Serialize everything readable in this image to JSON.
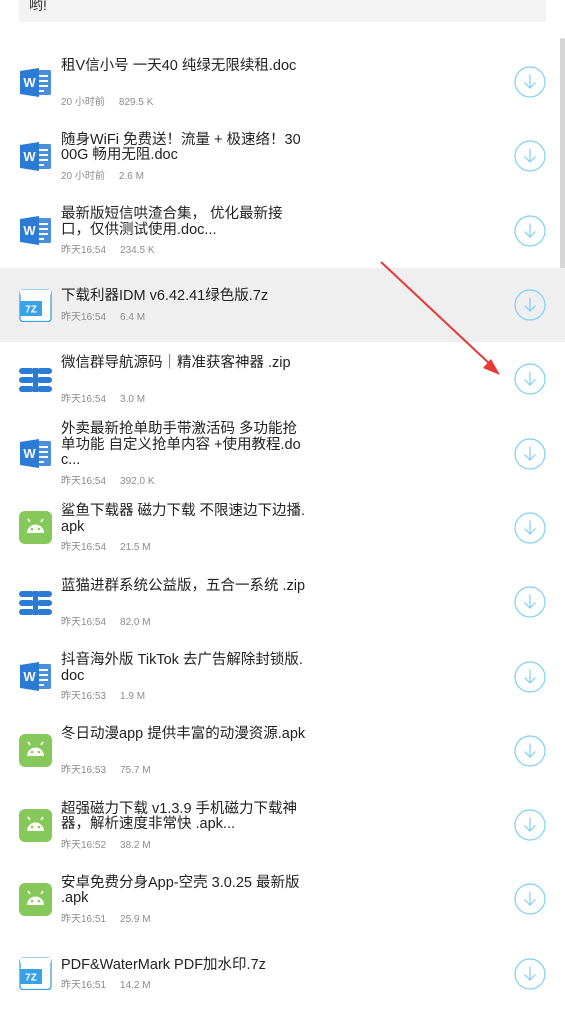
{
  "banner": {
    "text": "哟!"
  },
  "files": [
    {
      "icon": "word",
      "title": "租V信小号 一天40 纯绿无限续租.doc",
      "time": "20 小时前",
      "size": "829.5 K",
      "lines": 2
    },
    {
      "icon": "word",
      "title": "随身WiFi 免费送！流量 + 极速络！3000G 畅用无阻.doc",
      "time": "20 小时前",
      "size": "2.6 M",
      "lines": 2
    },
    {
      "icon": "word",
      "title": "最新版短信哄渣合集， 优化最新接口，仅供测试使用.doc...",
      "time": "昨天16:54",
      "size": "234.5 K",
      "lines": 2
    },
    {
      "icon": "7z",
      "title": "下载利器IDM v6.42.41绿色版.7z",
      "time": "昨天16:54",
      "size": "6.4 M",
      "lines": 1,
      "highlight": true
    },
    {
      "icon": "zip",
      "title": "微信群导航源码｜精准获客神器 .zip",
      "time": "昨天16:54",
      "size": "3.0 M",
      "lines": 2
    },
    {
      "icon": "word",
      "title": "外卖最新抢单助手带激活码 多功能抢单功能 自定义抢单内容 +使用教程.doc...",
      "time": "昨天16:54",
      "size": "392.0 K",
      "lines": 3
    },
    {
      "icon": "apk",
      "title": "鲨鱼下载器 磁力下载 不限速边下边播.apk",
      "time": "昨天16:54",
      "size": "21.5 M",
      "lines": 2
    },
    {
      "icon": "zip",
      "title": "蓝猫进群系统公益版，五合一系统 .zip",
      "time": "昨天16:54",
      "size": "82.0 M",
      "lines": 2
    },
    {
      "icon": "word",
      "title": "抖音海外版 TikTok 去广告解除封锁版.doc",
      "time": "昨天16:53",
      "size": "1.9 M",
      "lines": 2
    },
    {
      "icon": "apk",
      "title": "冬日动漫app 提供丰富的动漫资源.apk",
      "time": "昨天16:53",
      "size": "75.7 M",
      "lines": 2
    },
    {
      "icon": "apk",
      "title": "超强磁力下载 v1.3.9 手机磁力下载神器，解析速度非常快 .apk...",
      "time": "昨天16:52",
      "size": "38.2 M",
      "lines": 2
    },
    {
      "icon": "apk",
      "title": "安卓免费分身App-空壳 3.0.25 最新版 .apk",
      "time": "昨天16:51",
      "size": "25.9 M",
      "lines": 2
    },
    {
      "icon": "7z",
      "title": "PDF&WaterMark PDF加水印.7z",
      "time": "昨天16:51",
      "size": "14.2 M",
      "lines": 1
    }
  ],
  "colors": {
    "word": "#2b7ad6",
    "apk": "#86c95a",
    "zip": "#2b7ad6",
    "sevenz": "#3aa0e8",
    "download": "#7fd0f0",
    "arrow": "#e53935"
  }
}
